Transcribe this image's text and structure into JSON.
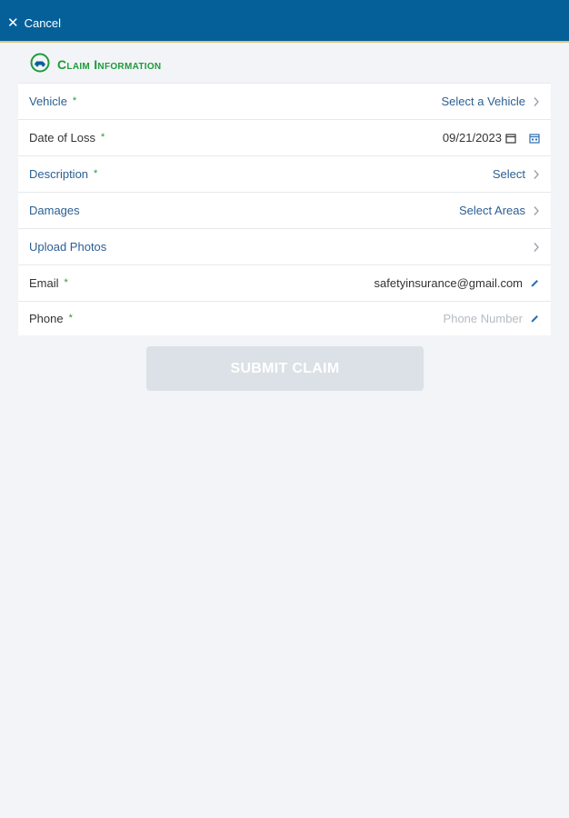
{
  "header": {
    "cancel_label": "Cancel"
  },
  "section": {
    "title": "Claim Information"
  },
  "form": {
    "vehicle": {
      "label": "Vehicle",
      "required": "*",
      "value": "Select a Vehicle"
    },
    "date_of_loss": {
      "label": "Date of Loss",
      "required": "*",
      "value": "09/21/2023"
    },
    "description": {
      "label": "Description",
      "required": "*",
      "value": "Select"
    },
    "damages": {
      "label": "Damages",
      "value": "Select Areas"
    },
    "upload_photos": {
      "label": "Upload Photos"
    },
    "email": {
      "label": "Email",
      "required": "*",
      "value": "safetyinsurance@gmail.com"
    },
    "phone": {
      "label": "Phone",
      "required": "*",
      "placeholder": "Phone Number"
    }
  },
  "submit": {
    "label": "SUBMIT CLAIM"
  },
  "colors": {
    "header_bg": "#05609a",
    "accent_green": "#1f9a3b",
    "link_blue": "#2c5f93",
    "page_bg": "#f2f4f7",
    "button_disabled": "#dbe1e6"
  },
  "icons": {
    "cancel": "close-icon",
    "section": "car-icon",
    "row_chevron": "chevron-right-icon",
    "date_picker": "calendar-icon",
    "edit": "pencil-icon"
  }
}
